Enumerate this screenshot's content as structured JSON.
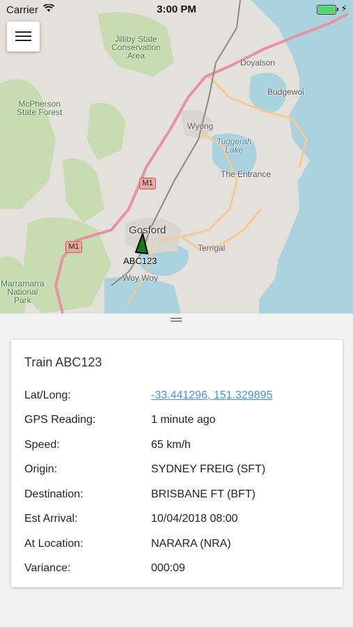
{
  "status_bar": {
    "carrier": "Carrier",
    "time": "3:00 PM"
  },
  "map": {
    "labels": {
      "jilliby": "Jilliby State\nConservation\nArea",
      "mcpherson": "McPherson\nState Forest",
      "doyalson": "Doyalson",
      "budgewoi": "Budgewoi",
      "wyong": "Wyong",
      "tuggerah": "Tuggerah\nLake",
      "the_entrance": "The Entrance",
      "gosford": "Gosford",
      "terrigal": "Terrigal",
      "woy_woy": "Woy Woy",
      "marramarra": "Marramarra\nNational\nPark"
    },
    "shields": {
      "m1_a": "M1",
      "m1_b": "M1"
    },
    "train_marker_label": "ABC123",
    "colors": {
      "land": "#e4e1dc",
      "forest": "#c8dcb2",
      "water": "#aad3df",
      "motorway": "#e892a2",
      "primary": "#f7c994"
    }
  },
  "train": {
    "title": "Train ABC123",
    "rows": [
      {
        "label": "Lat/Long:",
        "value": "-33.441296, 151.329895"
      },
      {
        "label": "GPS Reading:",
        "value": "1 minute ago"
      },
      {
        "label": "Speed:",
        "value": "65 km/h"
      },
      {
        "label": "Origin:",
        "value": "SYDNEY FREIG (SFT)"
      },
      {
        "label": "Destination:",
        "value": "BRISBANE FT (BFT)"
      },
      {
        "label": "Est Arrival:",
        "value": "10/04/2018 08:00"
      },
      {
        "label": "At Location:",
        "value": "NARARA (NRA)"
      },
      {
        "label": "Variance:",
        "value": "000:09"
      }
    ]
  }
}
